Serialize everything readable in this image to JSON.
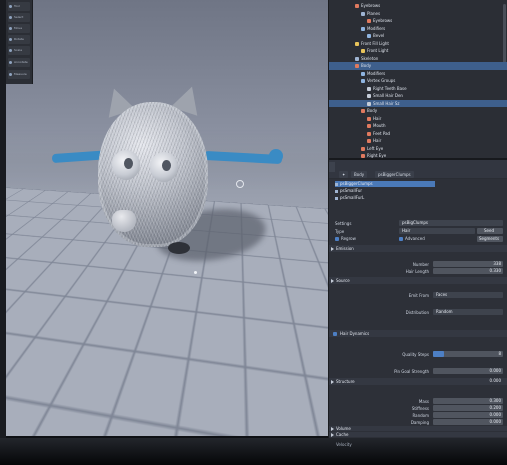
{
  "toolbar": {
    "tools": [
      {
        "label": "Tool"
      },
      {
        "label": "Select"
      },
      {
        "label": "Move"
      },
      {
        "label": "Rotate"
      },
      {
        "label": "Scale"
      },
      {
        "label": "Annotate"
      },
      {
        "label": "Measure"
      }
    ]
  },
  "viewport": {
    "footer": {
      "view": "View",
      "start": "Start",
      "start_value": "1",
      "end": "End",
      "end_value": "250"
    }
  },
  "outliner": {
    "rows": [
      {
        "label": "Eyebrows",
        "indent": 1,
        "color": "#e07a5f"
      },
      {
        "label": "Planes",
        "indent": 2,
        "color": "#9fb4d2"
      },
      {
        "label": "Eyebrows",
        "indent": 3,
        "color": "#e07a5f"
      },
      {
        "label": "Modifiers",
        "indent": 2,
        "color": "#8fb4e0"
      },
      {
        "label": "Bevel",
        "indent": 3,
        "color": "#8fb4e0"
      },
      {
        "label": "Front Fill Light",
        "indent": 1,
        "color": "#e8c35a"
      },
      {
        "label": "Front Light",
        "indent": 2,
        "color": "#e8c35a"
      },
      {
        "label": "Skeleton",
        "indent": 1,
        "color": "#9fb4d2"
      },
      {
        "label": "Body",
        "indent": 1,
        "color": "#e07a5f",
        "selected": true
      },
      {
        "label": "Modifiers",
        "indent": 2,
        "color": "#8fb4e0"
      },
      {
        "label": "Vertex Groups",
        "indent": 2,
        "color": "#8fb4e0"
      },
      {
        "label": "Right Teeth Base",
        "indent": 3,
        "color": "#c5ccd8"
      },
      {
        "label": "Small Hair Den",
        "indent": 3,
        "color": "#c5ccd8"
      },
      {
        "label": "Small Hair Sz",
        "indent": 3,
        "color": "#c5ccd8",
        "selected": true
      },
      {
        "label": "Body",
        "indent": 2,
        "color": "#e07a5f"
      },
      {
        "label": "Hair",
        "indent": 3,
        "color": "#e07a5f"
      },
      {
        "label": "Mouth",
        "indent": 3,
        "color": "#e07a5f"
      },
      {
        "label": "Feet Pad",
        "indent": 3,
        "color": "#e07a5f"
      },
      {
        "label": "Hair",
        "indent": 3,
        "color": "#e07a5f"
      },
      {
        "label": "Left Eye",
        "indent": 2,
        "color": "#e07a5f"
      },
      {
        "label": "Right Eye",
        "indent": 2,
        "color": "#e07a5f"
      }
    ]
  },
  "tabs": {
    "breadcrumb_object": "Body",
    "breadcrumb_system": "psBiggerClumps"
  },
  "particle_slots": [
    {
      "label": "psBiggerClumps",
      "selected": true
    },
    {
      "label": "psSmallFur"
    },
    {
      "label": "psSmallFurL"
    }
  ],
  "settings": {
    "settings_label": "Settings",
    "settings_value": "psBigClumps",
    "type_label": "Type",
    "type_value": "Hair",
    "seed_label": "Seed",
    "regrow_label": "Regrow",
    "advanced_label": "Advanced",
    "segments_label": "Segments"
  },
  "sections": {
    "emission": "Emission",
    "source": "Source",
    "hair_dynamics": "Hair Dynamics",
    "structure": "Structure",
    "volume": "Volume",
    "cache": "Cache",
    "velocity": "Velocity"
  },
  "emission": {
    "number_label": "Number",
    "number_value": "338",
    "hair_length_label": "Hair Length",
    "hair_length_value": "0.330"
  },
  "source": {
    "emit_from_label": "Emit From",
    "emit_from_value": "Faces",
    "distribution_label": "Distribution",
    "distribution_value": "Random"
  },
  "dynamics": {
    "quality_label": "Quality Steps",
    "quality_value": "8",
    "quality_fill": 0.15,
    "pin_label": "Pin Goal Strength",
    "pin_value": "0.000"
  },
  "structure": {
    "mass_label": "Mass",
    "mass_value": "0.300",
    "stiffness_label": "Stiffness",
    "stiffness_value": "0.200",
    "random_label": "Random",
    "random_value": "0.000",
    "damping_label": "Damping",
    "damping_value": "0.000",
    "struct_top_value": "0.000"
  },
  "colors": {
    "accent": "#4d7fc4",
    "arm": "#3a8bc4",
    "selection": "#3e5f8c"
  }
}
